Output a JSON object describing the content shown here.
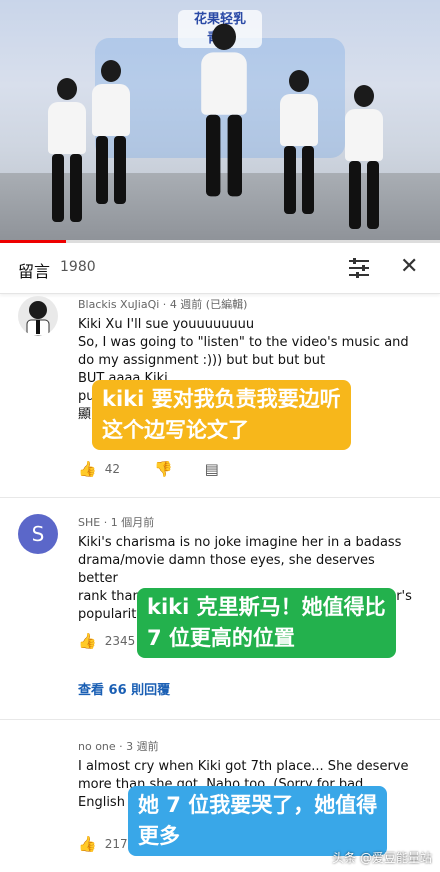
{
  "video": {
    "logo_line1": "花果轻乳",
    "logo_line2": "青春",
    "progress": 0.15
  },
  "header": {
    "title": "留言",
    "count": "1980"
  },
  "comments": [
    {
      "author": "Blackis XuJiaQi",
      "time": "4 週前 (已編輯)",
      "lines": [
        "Kiki Xu I'll sue youuuuuuuu",
        "So, I was going to \"listen\" to the video's music and",
        "do my assignment :))) but but but but",
        "BUT aaaa Kiki...",
        "put ...",
        "顯..."
      ],
      "likes": "42",
      "overlay_line1": "kiki 要对我负责我要边听",
      "overlay_line2": "这个边写论文了"
    },
    {
      "avatar_letter": "S",
      "author": "SHE",
      "time": "1 個月前",
      "lines": [
        "Kiki's charisma is no joke imagine her in a badass",
        "drama/movie damn those eyes, she deserves better",
        "rank than no. 7 i don't think she can't beat esther's",
        "popularity..."
      ],
      "likes": "2345",
      "replies": "查看 66 則回覆",
      "overlay_line1": "kiki 克里斯马！她值得比",
      "overlay_line2": "7 位更高的位置"
    },
    {
      "author": "no one",
      "time": "3 週前",
      "lines": [
        "I almost cry when Kiki got 7th place... She deserve",
        "more than she got. Naho too. (Sorry for bad",
        "English !)"
      ],
      "likes": "217",
      "dislikes": "1",
      "overlay_line1": "她 7 位我要哭了，她值得",
      "overlay_line2": "更多"
    }
  ],
  "watermark": "头条 @爱豆能量站"
}
